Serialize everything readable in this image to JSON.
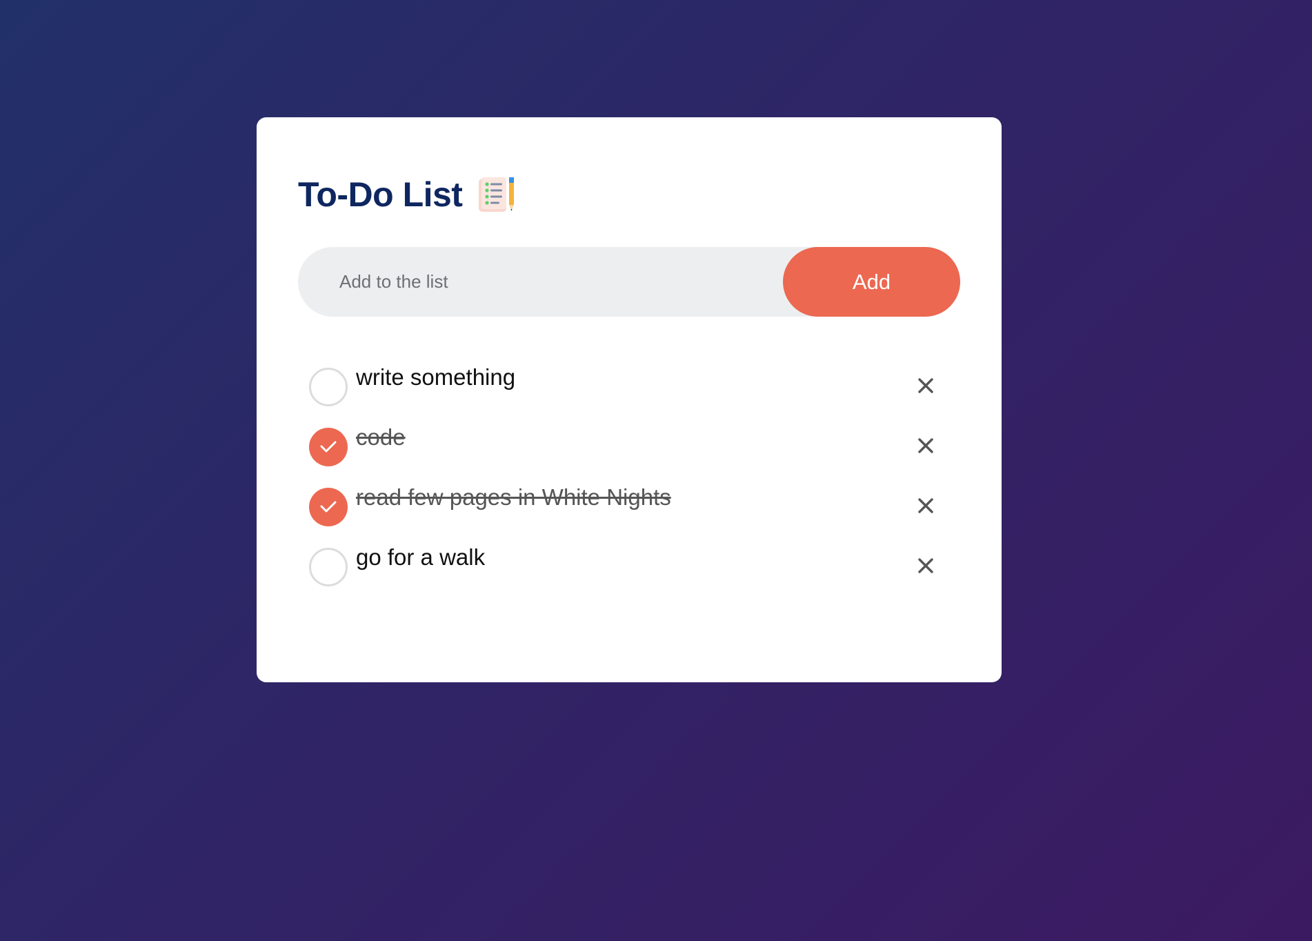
{
  "app": {
    "title": "To-Do List"
  },
  "input": {
    "placeholder": "Add to the list",
    "value": ""
  },
  "add_button": {
    "label": "Add"
  },
  "tasks": [
    {
      "text": "write something",
      "checked": false
    },
    {
      "text": "code",
      "checked": true
    },
    {
      "text": "read few pages in White Nights",
      "checked": true
    },
    {
      "text": "go for a walk",
      "checked": false
    }
  ],
  "icons": {
    "title": "checklist-pencil-icon",
    "check": "checkmark-icon",
    "delete": "close-icon"
  },
  "colors": {
    "accent": "#ec6851",
    "title": "#0f2760",
    "background_start": "#223069",
    "background_end": "#3c1a62"
  }
}
